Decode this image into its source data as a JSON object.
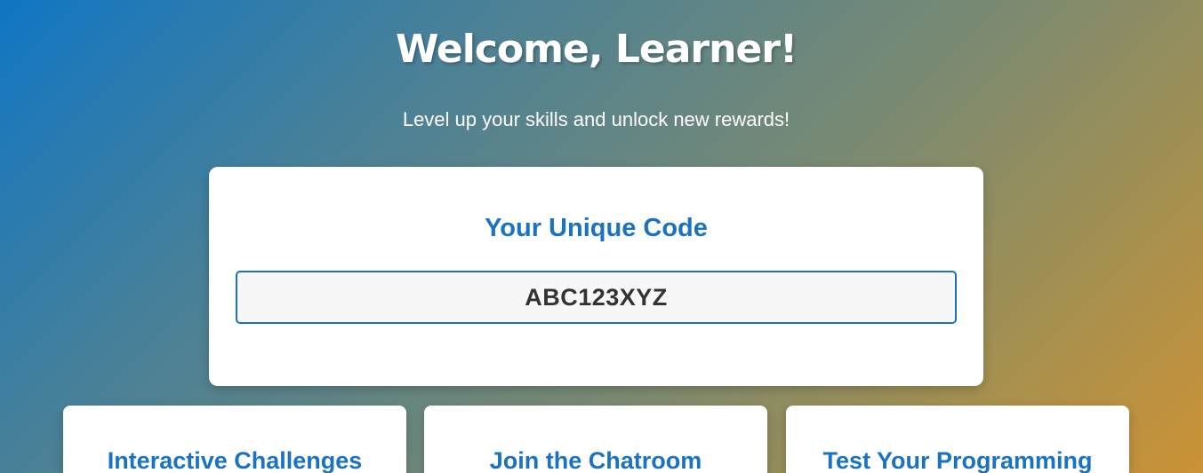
{
  "header": {
    "title": "Welcome, Learner!",
    "subtitle": "Level up your skills and unlock new rewards!"
  },
  "code_card": {
    "heading": "Your Unique Code",
    "code": "ABC123XYZ"
  },
  "features": [
    {
      "title": "Interactive Challenges"
    },
    {
      "title": "Join the Chatroom"
    },
    {
      "title": "Test Your Programming"
    }
  ],
  "colors": {
    "accent": "#1a73c2",
    "gradient_start": "#1076c4",
    "gradient_end": "#cc9236",
    "card_bg": "#ffffff"
  }
}
